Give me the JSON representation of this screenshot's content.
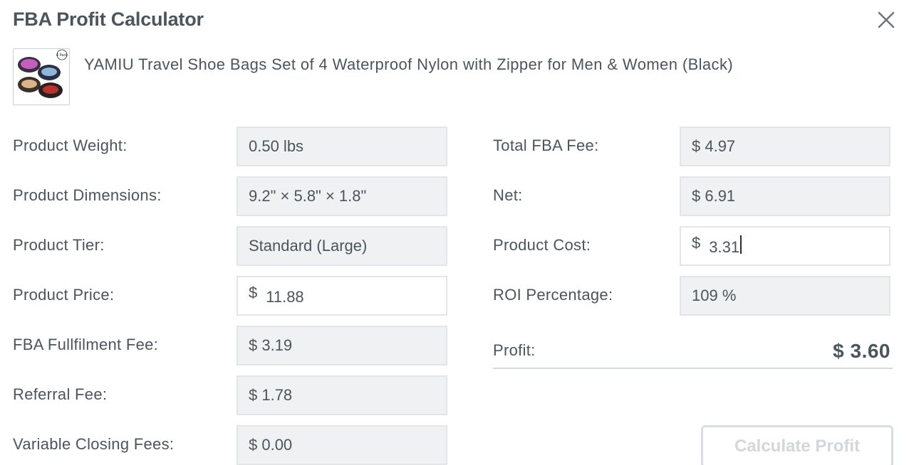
{
  "dialog": {
    "title": "FBA Profit Calculator"
  },
  "product": {
    "name": "YAMIU Travel Shoe Bags Set of 4 Waterproof Nylon with Zipper for Men & Women (Black)",
    "thumb_badge": "4 Pack"
  },
  "left": {
    "weight": {
      "label": "Product Weight:",
      "value": "0.50 lbs"
    },
    "dimensions": {
      "label": "Product Dimensions:",
      "value": "9.2\" × 5.8\" × 1.8\""
    },
    "tier": {
      "label": "Product Tier:",
      "value": "Standard (Large)"
    },
    "price": {
      "label": "Product Price:",
      "currency": "$",
      "value": "11.88"
    },
    "fulfilment_fee": {
      "label": "FBA Fullfilment Fee:",
      "value": "$ 3.19"
    },
    "referral_fee": {
      "label": "Referral Fee:",
      "value": "$ 1.78"
    },
    "closing_fees": {
      "label": "Variable Closing Fees:",
      "value": "$ 0.00"
    }
  },
  "right": {
    "total_fba_fee": {
      "label": "Total FBA Fee:",
      "value": "$ 4.97"
    },
    "net": {
      "label": "Net:",
      "value": "$ 6.91"
    },
    "product_cost": {
      "label": "Product Cost:",
      "currency": "$",
      "value": "3.31"
    },
    "roi": {
      "label": "ROI Percentage:",
      "value": "109 %"
    },
    "profit": {
      "label": "Profit:",
      "value": "$ 3.60"
    }
  },
  "actions": {
    "calculate_label": "Calculate Profit"
  }
}
